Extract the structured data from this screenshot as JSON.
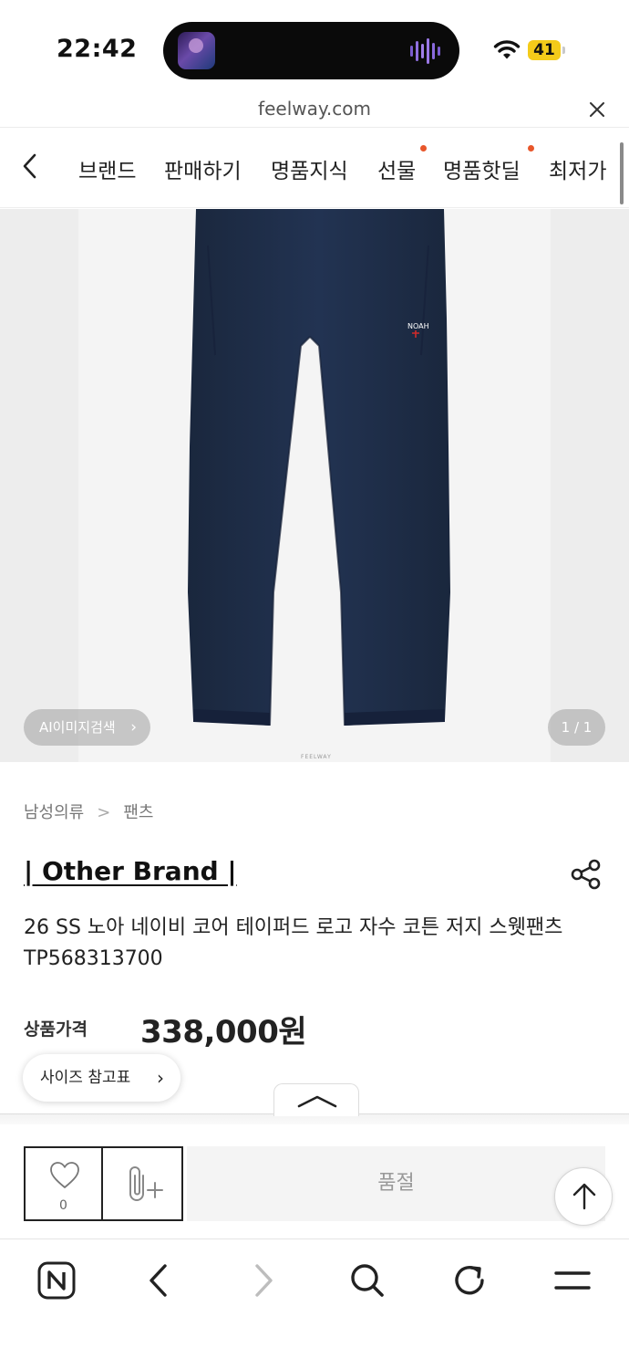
{
  "status_bar": {
    "time": "22:42",
    "battery": "41"
  },
  "url_bar": {
    "domain": "feelway.com"
  },
  "nav": {
    "items": [
      {
        "label": "브랜드",
        "dot": false
      },
      {
        "label": "판매하기",
        "dot": false
      },
      {
        "label": "명품지식",
        "dot": false
      },
      {
        "label": "선물",
        "dot": true
      },
      {
        "label": "명품핫딜",
        "dot": true
      },
      {
        "label": "최저가",
        "dot": false
      }
    ]
  },
  "hero": {
    "ai_search_label": "AI이미지검색",
    "page_counter": "1 / 1",
    "watermark": "FEELWAY",
    "logo_text": "NOAH"
  },
  "product": {
    "breadcrumb": [
      "남성의류",
      "팬츠"
    ],
    "brand": "| Other Brand |",
    "title": "26 SS 노아 네이비 코어 테이퍼드 로고 자수 코튼 저지 스웻팬츠 TP568313700",
    "price_label": "상품가격",
    "price": "338,000원",
    "size_chart_label": "사이즈 참고표"
  },
  "actions": {
    "like_count": "0",
    "soldout_label": "품절"
  },
  "colors": {
    "accent_dot": "#e8562a",
    "battery": "#f4cb1a",
    "pants": "#1f2d45"
  }
}
